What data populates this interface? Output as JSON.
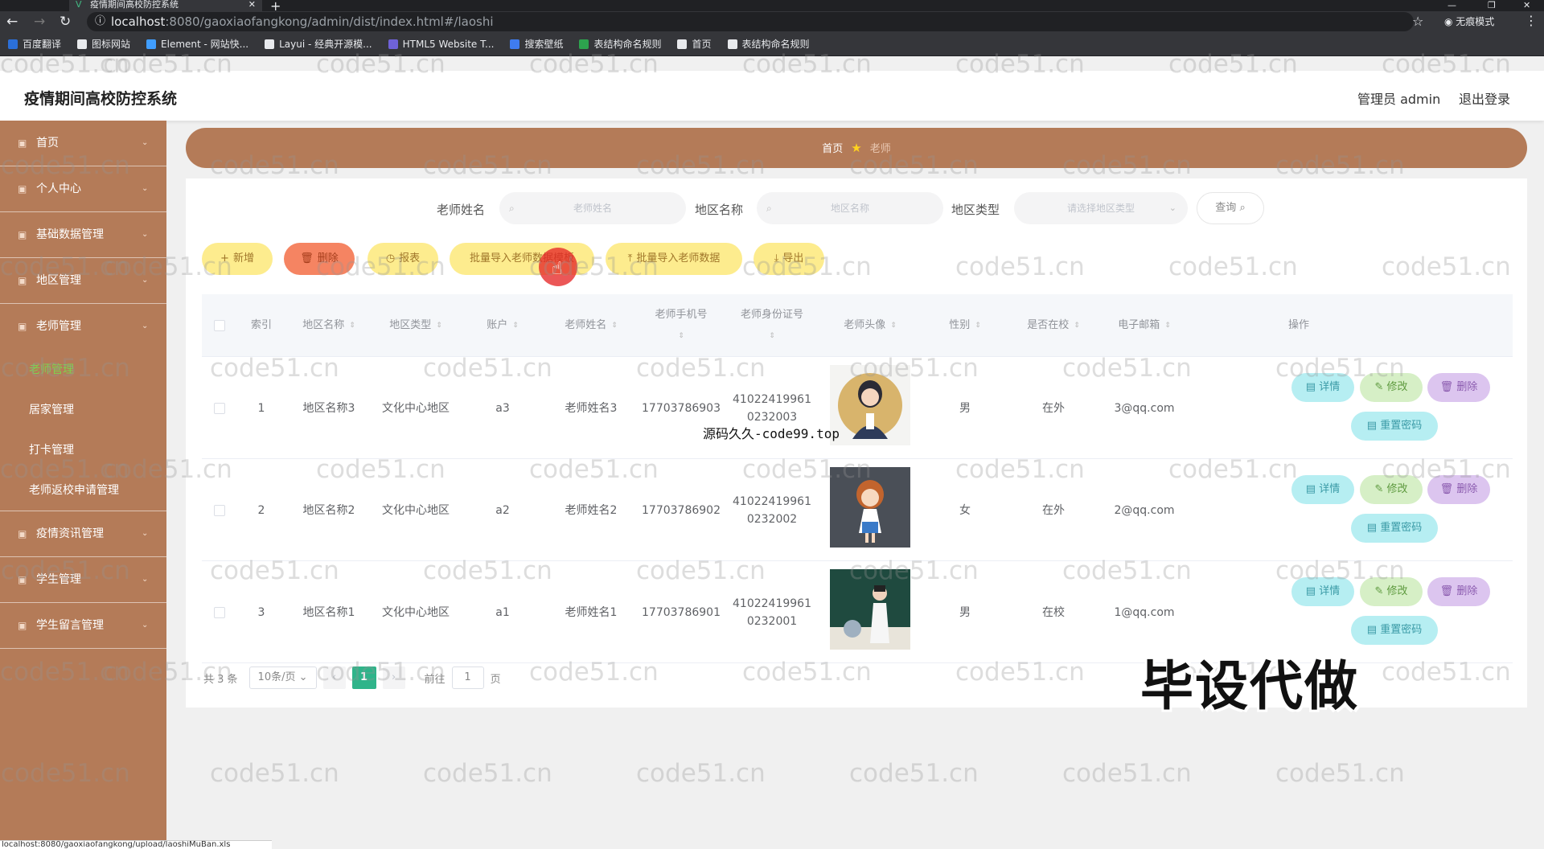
{
  "browser": {
    "tab_title": "疫情期间高校防控系统",
    "url_host": "localhost",
    "url_path": ":8080/gaoxiaofangkong/admin/dist/index.html#/laoshi",
    "incognito_label": "无痕模式",
    "bookmarks": [
      {
        "label": "百度翻译",
        "color": "#2b6fd8"
      },
      {
        "label": "图标网站",
        "color": "#e8eaed"
      },
      {
        "label": "Element - 网站快...",
        "color": "#409eff"
      },
      {
        "label": "Layui - 经典开源模...",
        "color": "#e8eaed"
      },
      {
        "label": "HTML5 Website T...",
        "color": "#6f62d9"
      },
      {
        "label": "搜索壁纸",
        "color": "#3f7cf0"
      },
      {
        "label": "表结构命名规则",
        "color": "#2da44e"
      },
      {
        "label": "首页",
        "color": "#e8eaed"
      },
      {
        "label": "表结构命名规则",
        "color": "#e8eaed"
      }
    ]
  },
  "header": {
    "title": "疫情期间高校防控系统",
    "user": "管理员 admin",
    "logout": "退出登录"
  },
  "sidebar": {
    "items": [
      {
        "label": "首页"
      },
      {
        "label": "个人中心"
      },
      {
        "label": "基础数据管理"
      },
      {
        "label": "地区管理"
      },
      {
        "label": "老师管理"
      }
    ],
    "teacher_sub": [
      {
        "label": "老师管理",
        "active": true
      },
      {
        "label": "居家管理"
      },
      {
        "label": "打卡管理"
      },
      {
        "label": "老师返校申请管理"
      }
    ],
    "items_after": [
      {
        "label": "疫情资讯管理"
      },
      {
        "label": "学生管理"
      },
      {
        "label": "学生留言管理"
      }
    ]
  },
  "breadcrumb": {
    "home": "首页",
    "current": "老师"
  },
  "search": {
    "teacher_name_label": "老师姓名",
    "teacher_name_placeholder": "老师姓名",
    "region_name_label": "地区名称",
    "region_name_placeholder": "地区名称",
    "region_type_label": "地区类型",
    "region_type_placeholder": "请选择地区类型",
    "query_button": "查询"
  },
  "actions": {
    "add": "新增",
    "delete": "删除",
    "report": "报表",
    "import_template": "批量导入老师数据模板",
    "import_data": "批量导入老师数据",
    "export": "导出"
  },
  "table": {
    "columns": {
      "index": "索引",
      "region_name": "地区名称",
      "region_type": "地区类型",
      "account": "账户",
      "teacher_name": "老师姓名",
      "phone": "老师手机号",
      "id_card": "老师身份证号",
      "avatar": "老师头像",
      "gender": "性别",
      "on_campus": "是否在校",
      "email": "电子邮箱",
      "ops": "操作"
    },
    "rows": [
      {
        "index": "1",
        "region_name": "地区名称3",
        "region_type": "文化中心地区",
        "account": "a3",
        "teacher_name": "老师姓名3",
        "phone": "17703786903",
        "id_card_1": "41022419961",
        "id_card_2": "0232003",
        "gender": "男",
        "on_campus": "在外",
        "email": "3@qq.com"
      },
      {
        "index": "2",
        "region_name": "地区名称2",
        "region_type": "文化中心地区",
        "account": "a2",
        "teacher_name": "老师姓名2",
        "phone": "17703786902",
        "id_card_1": "41022419961",
        "id_card_2": "0232002",
        "gender": "女",
        "on_campus": "在外",
        "email": "2@qq.com"
      },
      {
        "index": "3",
        "region_name": "地区名称1",
        "region_type": "文化中心地区",
        "account": "a1",
        "teacher_name": "老师姓名1",
        "phone": "17703786901",
        "id_card_1": "41022419961",
        "id_card_2": "0232001",
        "gender": "男",
        "on_campus": "在校",
        "email": "1@qq.com"
      }
    ],
    "op_labels": {
      "detail": "详情",
      "edit": "修改",
      "delete": "删除",
      "reset": "重置密码"
    }
  },
  "pagination": {
    "total": "共 3 条",
    "page_size": "10条/页",
    "current": "1",
    "goto_label": "前往",
    "goto_value": "1",
    "page_suffix": "页"
  },
  "overlays": {
    "watermark": "code51.cn",
    "source_note": "源码久久-code99.top",
    "banner": "毕设代做",
    "status_url": "localhost:8080/gaoxiaofangkong/upload/laoshiMuBan.xls"
  },
  "colors": {
    "sidebar": "#b47b58",
    "active_menu": "#7dd34f",
    "pager_active": "#2fb48a"
  }
}
